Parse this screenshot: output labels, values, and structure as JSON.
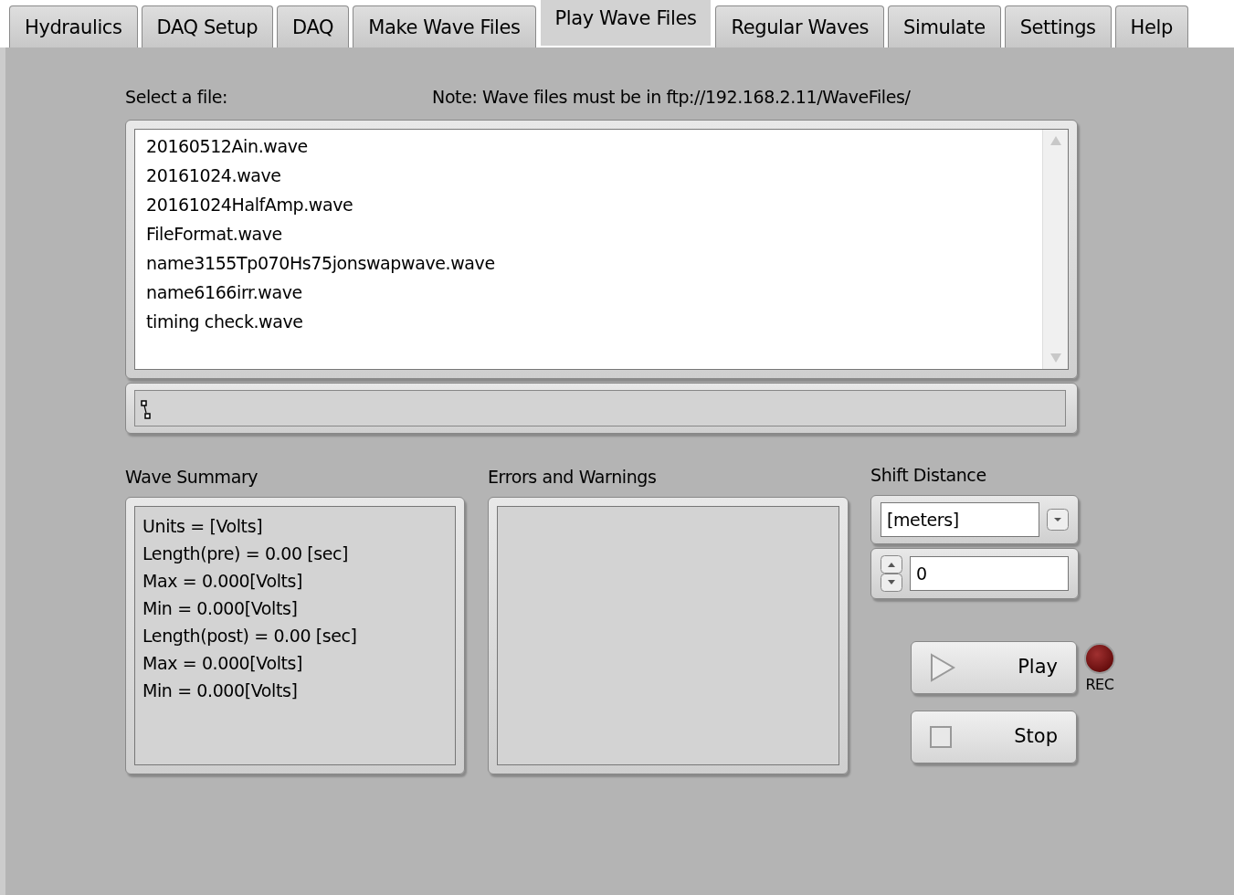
{
  "tabs": [
    {
      "label": "Hydraulics",
      "selected": false
    },
    {
      "label": "DAQ Setup",
      "selected": false
    },
    {
      "label": "DAQ",
      "selected": false
    },
    {
      "label": "Make Wave Files",
      "selected": false
    },
    {
      "label": "Play Wave Files",
      "selected": true
    },
    {
      "label": "Regular Waves",
      "selected": false
    },
    {
      "label": "Simulate",
      "selected": false
    },
    {
      "label": "Settings",
      "selected": false
    },
    {
      "label": "Help",
      "selected": false
    }
  ],
  "file_select": {
    "label": "Select a file:",
    "note": "Note: Wave files must be in ftp://192.168.2.11/WaveFiles/",
    "files": [
      {
        "name": "20160512Ain.wave",
        "selected": false
      },
      {
        "name": "20161024.wave",
        "selected": false
      },
      {
        "name": "20161024HalfAmp.wave",
        "selected": false
      },
      {
        "name": "FileFormat.wave",
        "selected": false
      },
      {
        "name": "name3155Tp070Hs75jonswapwave.wave",
        "selected": false
      },
      {
        "name": "name6166irr.wave",
        "selected": false
      },
      {
        "name": "timing check.wave",
        "selected": false
      }
    ]
  },
  "wave_summary": {
    "label": "Wave Summary",
    "lines": [
      "Units = [Volts]",
      "Length(pre) = 0.00 [sec]",
      "Max = 0.000[Volts]",
      "Min = 0.000[Volts]",
      "Length(post) = 0.00 [sec]",
      "Max = 0.000[Volts]",
      "Min = 0.000[Volts]"
    ]
  },
  "errors": {
    "label": "Errors and Warnings"
  },
  "shift_distance": {
    "label": "Shift Distance",
    "unit": "[meters]",
    "value": "0"
  },
  "buttons": [
    {
      "label": "Play",
      "kind": "play"
    },
    {
      "label": "Stop",
      "kind": "stop"
    }
  ],
  "rec_led": {
    "label": "REC",
    "on": false
  }
}
